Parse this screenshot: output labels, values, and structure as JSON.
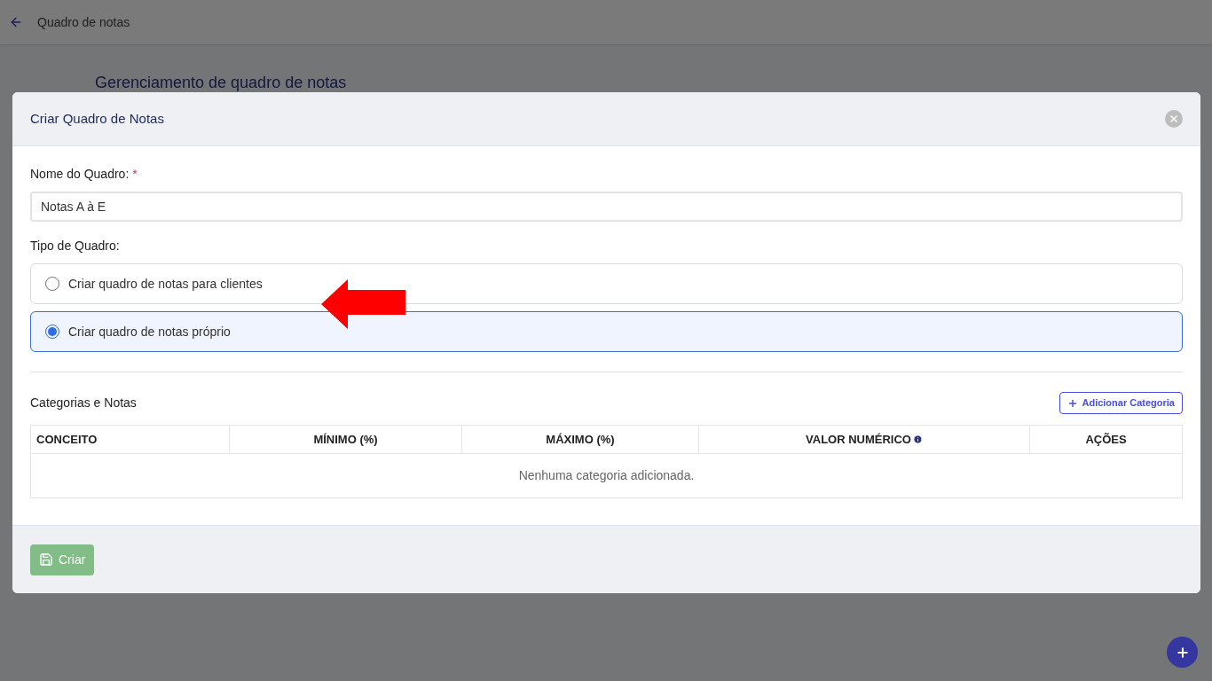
{
  "topbar": {
    "title": "Quadro de notas"
  },
  "page": {
    "heading": "Gerenciamento de quadro de notas"
  },
  "modal": {
    "title": "Criar Quadro de Notas",
    "name_field": {
      "label": "Nome do Quadro:",
      "required_mark": "*",
      "value": "Notas A à E"
    },
    "type_label": "Tipo de Quadro:",
    "type_options": [
      {
        "label": "Criar quadro de notas para clientes",
        "selected": false
      },
      {
        "label": "Criar quadro de notas próprio",
        "selected": true
      }
    ],
    "section_title": "Categorias e Notas",
    "add_button": "Adicionar Categoria",
    "table": {
      "columns": [
        {
          "label": "CONCEITO",
          "info": false
        },
        {
          "label": "MÍNIMO (%)",
          "info": false
        },
        {
          "label": "MÁXIMO (%)",
          "info": false
        },
        {
          "label": "VALOR NUMÉRICO",
          "info": true
        },
        {
          "label": "AÇÕES",
          "info": false
        }
      ],
      "empty_message": "Nenhuma categoria adicionada."
    },
    "submit_button": {
      "label": "Criar",
      "disabled": true
    }
  }
}
